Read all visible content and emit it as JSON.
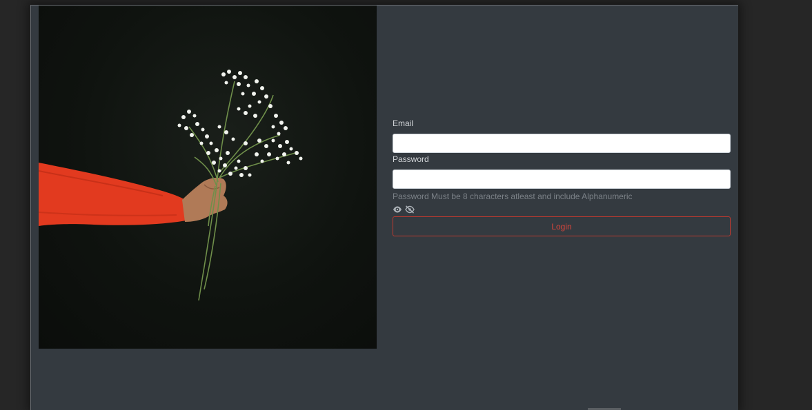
{
  "form": {
    "email_label": "Email",
    "email_value": "",
    "password_label": "Password",
    "password_value": "",
    "password_hint": "Password Must be 8 characters atleast and include Alphanumeric",
    "login_label": "Login"
  },
  "icons": {
    "show_password": "eye-icon",
    "hide_password": "eye-slash-icon"
  },
  "colors": {
    "panel_bg": "#343a40",
    "page_bg": "#262626",
    "login_accent": "#d9453b",
    "hint_text": "#7b8187"
  }
}
